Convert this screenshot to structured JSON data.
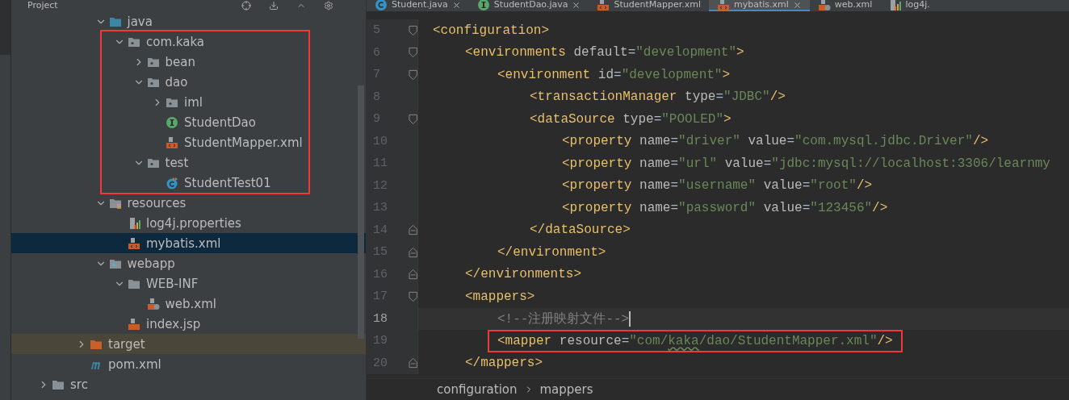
{
  "project_panel": {
    "title": "Project"
  },
  "tree": [
    {
      "children": [
        {
          "children": [
            {
              "children": [
                {
                  "label": "java",
                  "kind": "source-folder",
                  "expanded": true,
                  "selected": false,
                  "children": [
                    {
                      "label": "com.kaka",
                      "kind": "package",
                      "expanded": true,
                      "selected": false,
                      "highlighted": true,
                      "children": [
                        {
                          "label": "bean",
                          "kind": "package",
                          "expanded": false,
                          "selected": false
                        },
                        {
                          "label": "dao",
                          "kind": "package",
                          "expanded": true,
                          "selected": false,
                          "children": [
                            {
                              "label": "iml",
                              "kind": "package",
                              "expanded": false,
                              "selected": false
                            },
                            {
                              "label": "StudentDao",
                              "kind": "interface",
                              "selected": false
                            },
                            {
                              "label": "StudentMapper.xml",
                              "kind": "xml",
                              "selected": false
                            }
                          ]
                        },
                        {
                          "label": "test",
                          "kind": "package",
                          "expanded": true,
                          "selected": false,
                          "children": [
                            {
                              "label": "StudentTest01",
                              "kind": "test-class",
                              "selected": false
                            }
                          ]
                        }
                      ]
                    }
                  ]
                },
                {
                  "label": "resources",
                  "kind": "resources-folder",
                  "expanded": true,
                  "selected": false,
                  "children": [
                    {
                      "label": "log4j.properties",
                      "kind": "properties",
                      "selected": false
                    },
                    {
                      "label": "mybatis.xml",
                      "kind": "xml",
                      "selected": true
                    }
                  ]
                },
                {
                  "label": "webapp",
                  "kind": "web-folder",
                  "expanded": true,
                  "selected": false,
                  "children": [
                    {
                      "label": "WEB-INF",
                      "kind": "folder",
                      "expanded": true,
                      "selected": false,
                      "children": [
                        {
                          "label": "web.xml",
                          "kind": "web-xml",
                          "selected": false
                        }
                      ]
                    },
                    {
                      "label": "index.jsp",
                      "kind": "jsp",
                      "selected": false
                    }
                  ]
                }
              ]
            },
            {
              "label": "target",
              "kind": "excluded-folder",
              "expanded": false,
              "selected": false
            },
            {
              "label": "pom.xml",
              "kind": "maven",
              "selected": false
            }
          ]
        }
      ]
    },
    {
      "label": "src",
      "kind": "folder",
      "expanded": false,
      "selected": false
    }
  ],
  "editor_tabs": [
    {
      "label": "Student.java",
      "kind": "class",
      "selected": false,
      "closable": true
    },
    {
      "label": "StudentDao.java",
      "kind": "interface",
      "selected": false,
      "closable": true
    },
    {
      "label": "StudentMapper.xml",
      "kind": "xml",
      "selected": false,
      "closable": false
    },
    {
      "label": "mybatis.xml",
      "kind": "xml",
      "selected": true,
      "closable": true
    },
    {
      "label": "web.xml",
      "kind": "web-xml",
      "selected": false,
      "closable": false
    },
    {
      "label": "log4j.",
      "kind": "properties",
      "selected": false,
      "closable": false
    }
  ],
  "code_lines": [
    {
      "number": "5",
      "fold_start": true,
      "fold_end": false,
      "current": false,
      "highlighted": false,
      "tokens": [
        {
          "kind": "tag",
          "text": "<configuration>"
        }
      ],
      "children": [
        {
          "number": "6",
          "fold_start": true,
          "fold_end": false,
          "current": false,
          "highlighted": false,
          "tokens": [
            {
              "kind": "tag",
              "text": "<environments"
            },
            {
              "kind": "attr",
              "text": " default"
            },
            {
              "kind": "plain",
              "text": "="
            },
            {
              "kind": "string",
              "text": "\"development\""
            },
            {
              "kind": "tag",
              "text": ">"
            }
          ],
          "children": [
            {
              "number": "7",
              "fold_start": true,
              "fold_end": false,
              "current": false,
              "highlighted": false,
              "tokens": [
                {
                  "kind": "tag",
                  "text": "<environment"
                },
                {
                  "kind": "attr",
                  "text": " id"
                },
                {
                  "kind": "plain",
                  "text": "="
                },
                {
                  "kind": "string",
                  "text": "\"development\""
                },
                {
                  "kind": "tag",
                  "text": ">"
                }
              ],
              "children": [
                {
                  "number": "8",
                  "fold_start": false,
                  "fold_end": false,
                  "current": false,
                  "highlighted": false,
                  "tokens": [
                    {
                      "kind": "tag",
                      "text": "<transactionManager"
                    },
                    {
                      "kind": "attr",
                      "text": " type"
                    },
                    {
                      "kind": "plain",
                      "text": "="
                    },
                    {
                      "kind": "string",
                      "text": "\"JDBC\""
                    },
                    {
                      "kind": "tag",
                      "text": "/>"
                    }
                  ]
                },
                {
                  "number": "9",
                  "fold_start": true,
                  "fold_end": false,
                  "current": false,
                  "highlighted": false,
                  "tokens": [
                    {
                      "kind": "tag",
                      "text": "<dataSource"
                    },
                    {
                      "kind": "attr",
                      "text": " type"
                    },
                    {
                      "kind": "plain",
                      "text": "="
                    },
                    {
                      "kind": "string",
                      "text": "\"POOLED\""
                    },
                    {
                      "kind": "tag",
                      "text": ">"
                    }
                  ],
                  "children": [
                    {
                      "number": "10",
                      "fold_start": false,
                      "fold_end": false,
                      "current": false,
                      "highlighted": false,
                      "tokens": [
                        {
                          "kind": "tag",
                          "text": "<property"
                        },
                        {
                          "kind": "attr",
                          "text": " name"
                        },
                        {
                          "kind": "plain",
                          "text": "="
                        },
                        {
                          "kind": "string",
                          "text": "\"driver\""
                        },
                        {
                          "kind": "attr",
                          "text": " value"
                        },
                        {
                          "kind": "plain",
                          "text": "="
                        },
                        {
                          "kind": "string",
                          "text": "\"com.mysql.jdbc.Driver\""
                        },
                        {
                          "kind": "tag",
                          "text": "/>"
                        }
                      ]
                    },
                    {
                      "number": "11",
                      "fold_start": false,
                      "fold_end": false,
                      "current": false,
                      "highlighted": false,
                      "tokens": [
                        {
                          "kind": "tag",
                          "text": "<property"
                        },
                        {
                          "kind": "attr",
                          "text": " name"
                        },
                        {
                          "kind": "plain",
                          "text": "="
                        },
                        {
                          "kind": "string",
                          "text": "\"url\""
                        },
                        {
                          "kind": "attr",
                          "text": " value"
                        },
                        {
                          "kind": "plain",
                          "text": "="
                        },
                        {
                          "kind": "string",
                          "text": "\"jdbc:mysql://localhost:3306/learnmy"
                        }
                      ]
                    },
                    {
                      "number": "12",
                      "fold_start": false,
                      "fold_end": false,
                      "current": false,
                      "highlighted": false,
                      "tokens": [
                        {
                          "kind": "tag",
                          "text": "<property"
                        },
                        {
                          "kind": "attr",
                          "text": " name"
                        },
                        {
                          "kind": "plain",
                          "text": "="
                        },
                        {
                          "kind": "string",
                          "text": "\"username\""
                        },
                        {
                          "kind": "attr",
                          "text": " value"
                        },
                        {
                          "kind": "plain",
                          "text": "="
                        },
                        {
                          "kind": "string",
                          "text": "\"root\""
                        },
                        {
                          "kind": "tag",
                          "text": "/>"
                        }
                      ]
                    },
                    {
                      "number": "13",
                      "fold_start": false,
                      "fold_end": false,
                      "current": false,
                      "highlighted": false,
                      "tokens": [
                        {
                          "kind": "tag",
                          "text": "<property"
                        },
                        {
                          "kind": "attr",
                          "text": " name"
                        },
                        {
                          "kind": "plain",
                          "text": "="
                        },
                        {
                          "kind": "string",
                          "text": "\"password\""
                        },
                        {
                          "kind": "attr",
                          "text": " value"
                        },
                        {
                          "kind": "plain",
                          "text": "="
                        },
                        {
                          "kind": "string",
                          "text": "\"123456\""
                        },
                        {
                          "kind": "tag",
                          "text": "/>"
                        }
                      ]
                    }
                  ]
                },
                {
                  "number": "14",
                  "fold_start": false,
                  "fold_end": true,
                  "current": false,
                  "highlighted": false,
                  "tokens": [
                    {
                      "kind": "tag",
                      "text": "</dataSource>"
                    }
                  ]
                }
              ]
            },
            {
              "number": "15",
              "fold_start": false,
              "fold_end": true,
              "current": false,
              "highlighted": false,
              "tokens": [
                {
                  "kind": "tag",
                  "text": "</environment>"
                }
              ]
            }
          ]
        },
        {
          "number": "16",
          "fold_start": false,
          "fold_end": true,
          "current": false,
          "highlighted": false,
          "tokens": [
            {
              "kind": "tag",
              "text": "</environments>"
            }
          ]
        },
        {
          "number": "17",
          "fold_start": true,
          "fold_end": false,
          "current": false,
          "highlighted": false,
          "tokens": [
            {
              "kind": "tag",
              "text": "<mappers>"
            }
          ],
          "children": [
            {
              "number": "18",
              "fold_start": false,
              "fold_end": false,
              "current": true,
              "highlighted": false,
              "tokens": [
                {
                  "kind": "comment",
                  "text": "<!--注册映射文件-->"
                }
              ]
            },
            {
              "number": "19",
              "fold_start": false,
              "fold_end": false,
              "current": false,
              "highlighted": true,
              "tokens": [
                {
                  "kind": "tag",
                  "text": "<mapper"
                },
                {
                  "kind": "attr",
                  "text": " resource"
                },
                {
                  "kind": "plain",
                  "text": "="
                },
                {
                  "kind": "string",
                  "text": "\"com/"
                },
                {
                  "kind": "string-typo",
                  "text": "kaka"
                },
                {
                  "kind": "string",
                  "text": "/dao/StudentMapper.xml\""
                },
                {
                  "kind": "tag",
                  "text": "/>"
                }
              ]
            }
          ]
        },
        {
          "number": "20",
          "fold_start": false,
          "fold_end": true,
          "current": false,
          "highlighted": false,
          "tokens": [
            {
              "kind": "tag",
              "text": "</mappers>"
            }
          ]
        }
      ]
    }
  ],
  "breadcrumbs": [
    "configuration",
    "mappers"
  ]
}
